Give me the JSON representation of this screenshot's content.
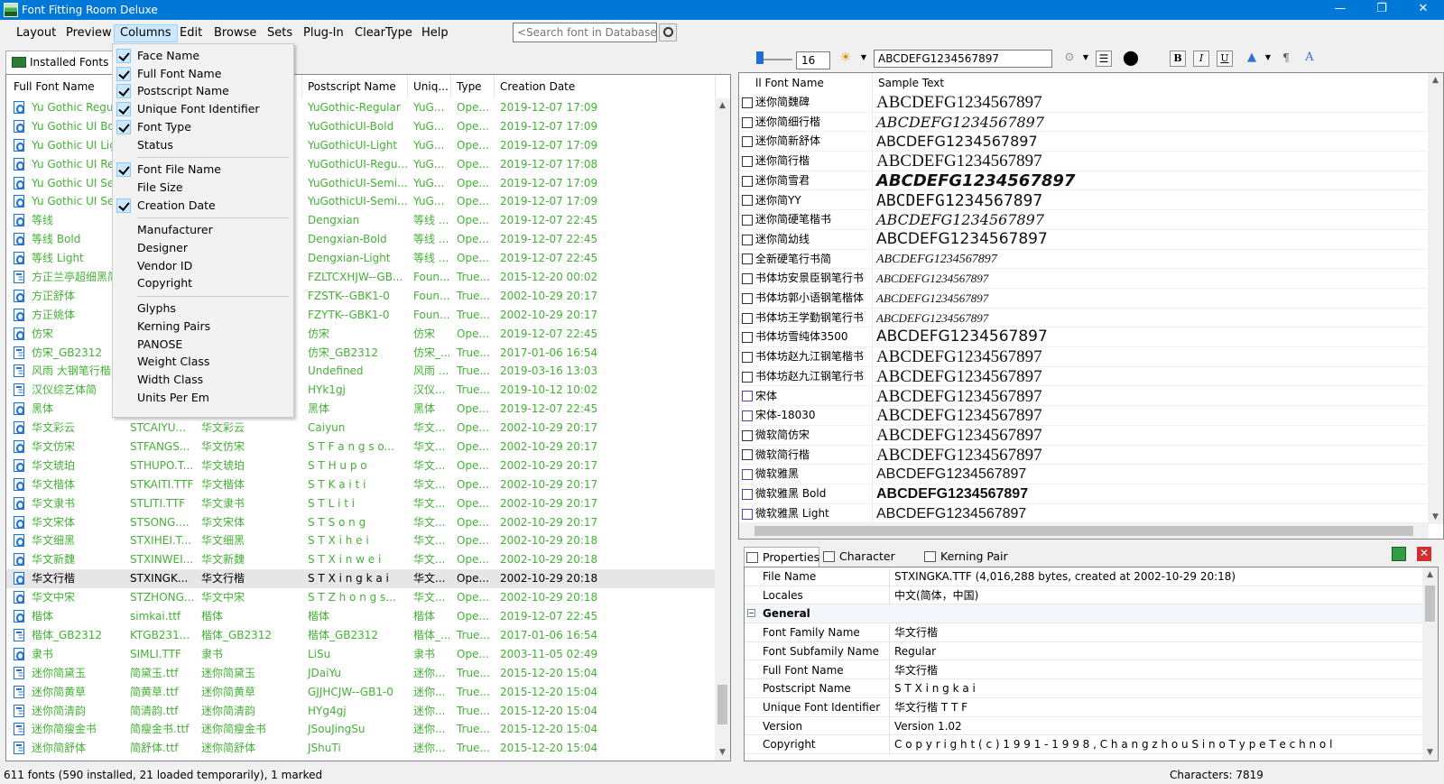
{
  "window": {
    "title": "Font Fitting Room Deluxe"
  },
  "menu": [
    "Layout",
    "Preview",
    "Columns",
    "Edit",
    "Browse",
    "Sets",
    "Plug-In",
    "ClearType",
    "Help"
  ],
  "search": {
    "placeholder": "<Search font in Database>"
  },
  "left_tab": "Installed Fonts",
  "columns_menu": [
    {
      "label": "Face Name",
      "checked": true
    },
    {
      "label": "Full Font Name",
      "checked": true
    },
    {
      "label": "Postscript Name",
      "checked": true
    },
    {
      "label": "Unique Font Identifier",
      "checked": true
    },
    {
      "label": "Font Type",
      "checked": true
    },
    {
      "label": "Status",
      "checked": false
    },
    {
      "sep": true
    },
    {
      "label": "Font File Name",
      "checked": true
    },
    {
      "label": "File Size",
      "checked": false
    },
    {
      "label": "Creation Date",
      "checked": true
    },
    {
      "sep": true
    },
    {
      "label": "Manufacturer",
      "checked": false
    },
    {
      "label": "Designer",
      "checked": false
    },
    {
      "label": "Vendor ID",
      "checked": false
    },
    {
      "label": "Copyright",
      "checked": false
    },
    {
      "sep": true
    },
    {
      "label": "Glyphs",
      "checked": false
    },
    {
      "label": "Kerning Pairs",
      "checked": false
    },
    {
      "label": "PANOSE",
      "checked": false
    },
    {
      "label": "Weight Class",
      "checked": false
    },
    {
      "label": "Width Class",
      "checked": false
    },
    {
      "label": "Units Per Em",
      "checked": false
    }
  ],
  "font_table": {
    "headers": [
      "Full Font Name",
      "Postscript Name",
      "Uniq...",
      "Type",
      "Creation Date"
    ],
    "rows": [
      [
        "o",
        "Yu Gothic Regul",
        "",
        "",
        "YuGothic-Regular",
        "YuG...",
        "Ope...",
        "2019-12-07 17:09"
      ],
      [
        "o",
        "Yu Gothic UI Bol",
        "",
        "",
        "YuGothicUI-Bold",
        "YuG...",
        "Ope...",
        "2019-12-07 17:09"
      ],
      [
        "o",
        "Yu Gothic UI Lig",
        "",
        "",
        "YuGothicUI-Light",
        "YuG...",
        "Ope...",
        "2019-12-07 17:09"
      ],
      [
        "o",
        "Yu Gothic UI Re.",
        "",
        "",
        "YuGothicUI-Regu...",
        "YuG...",
        "Ope...",
        "2019-12-07 17:08"
      ],
      [
        "o",
        "Yu Gothic UI Se.",
        "",
        "",
        "YuGothicUI-Semi...",
        "YuG...",
        "Ope...",
        "2019-12-07 17:09"
      ],
      [
        "o",
        "Yu Gothic UI Se.",
        "",
        "",
        "YuGothicUI-Semi...",
        "YuG...",
        "Ope...",
        "2019-12-07 17:09"
      ],
      [
        "o",
        "等线",
        "",
        "",
        "Dengxian",
        "等线 ...",
        "Ope...",
        "2019-12-07 22:45"
      ],
      [
        "o",
        "等线 Bold",
        "",
        "",
        "Dengxian-Bold",
        "等线 ...",
        "Ope...",
        "2019-12-07 22:45"
      ],
      [
        "o",
        "等线 Light",
        "",
        "",
        "Dengxian-Light",
        "等线 ...",
        "Ope...",
        "2019-12-07 22:45"
      ],
      [
        "t",
        "方正兰亭超细黑简",
        "",
        "",
        "FZLTCXHJW--GB...",
        "Foun...",
        "True...",
        "2015-12-20 00:02"
      ],
      [
        "o",
        "方正舒体",
        "",
        "",
        "FZSTK--GBK1-0",
        "Foun...",
        "True...",
        "2002-10-29 20:17"
      ],
      [
        "o",
        "方正姚体",
        "",
        "",
        "FZYTK--GBK1-0",
        "Foun...",
        "True...",
        "2002-10-29 20:17"
      ],
      [
        "o",
        "仿宋",
        "",
        "",
        "仿宋",
        "仿宋",
        "Ope...",
        "2019-12-07 22:45"
      ],
      [
        "t",
        "仿宋_GB2312",
        "",
        "",
        "仿宋_GB2312",
        "仿宋_...",
        "True...",
        "2017-01-06 16:54"
      ],
      [
        "t",
        "风雨 大钢笔行楷",
        "",
        "",
        "Undefined",
        "风雨 ...",
        "True...",
        "2019-03-16 13:03"
      ],
      [
        "t",
        "汉仪综艺体简",
        "",
        "",
        "HYk1gj",
        "汉仪...",
        "True...",
        "2019-10-12 10:02"
      ],
      [
        "o",
        "黑体",
        "",
        "",
        "黑体",
        "黑体",
        "Ope...",
        "2019-12-07 22:45"
      ],
      [
        "o",
        "华文彩云",
        "STCAIYU...",
        "华文彩云",
        "Caiyun",
        "华文...",
        "Ope...",
        "2002-10-29 20:17"
      ],
      [
        "o",
        "华文仿宋",
        "STFANGS...",
        "华文仿宋",
        "S T F a n g s o...",
        "华文...",
        "Ope...",
        "2002-10-29 20:17"
      ],
      [
        "o",
        "华文琥珀",
        "STHUPO.T...",
        "华文琥珀",
        "S T H u p o",
        "华文...",
        "Ope...",
        "2002-10-29 20:17"
      ],
      [
        "o",
        "华文楷体",
        "STKAITI.TTF",
        "华文楷体",
        "S T K a i t i",
        "华文...",
        "Ope...",
        "2002-10-29 20:17"
      ],
      [
        "o",
        "华文隶书",
        "STLITI.TTF",
        "华文隶书",
        "S T L i t i",
        "华文...",
        "Ope...",
        "2002-10-29 20:17"
      ],
      [
        "o",
        "华文宋体",
        "STSONG....",
        "华文宋体",
        "S T S o n g",
        "华文...",
        "Ope...",
        "2002-10-29 20:17"
      ],
      [
        "o",
        "华文细黑",
        "STXIHEI.T...",
        "华文细黑",
        "S T X i h e i",
        "华文...",
        "Ope...",
        "2002-10-29 20:18"
      ],
      [
        "o",
        "华文新魏",
        "STXINWEI...",
        "华文新魏",
        "S T X i n w e i",
        "华文...",
        "Ope...",
        "2002-10-29 20:18"
      ],
      [
        "o",
        "华文行楷",
        "STXINGK...",
        "华文行楷",
        "S T X i n g k a i",
        "华文...",
        "Ope...",
        "2002-10-29 20:18"
      ],
      [
        "o",
        "华文中宋",
        "STZHONG...",
        "华文中宋",
        "S T Z h o n g s...",
        "华文...",
        "Ope...",
        "2002-10-29 20:18"
      ],
      [
        "o",
        "楷体",
        "simkai.ttf",
        "楷体",
        "楷体",
        "楷体",
        "Ope...",
        "2019-12-07 22:45"
      ],
      [
        "t",
        "楷体_GB2312",
        "KTGB231...",
        "楷体_GB2312",
        "楷体_GB2312",
        "楷体_...",
        "True...",
        "2017-01-06 16:54"
      ],
      [
        "o",
        "隶书",
        "SIMLI.TTF",
        "隶书",
        "LiSu",
        "隶书",
        "Ope...",
        "2003-11-05 02:49"
      ],
      [
        "t",
        "迷你简黛玉",
        "简黛玉.ttf",
        "迷你简黛玉",
        "JDaiYu",
        "迷你...",
        "True...",
        "2015-12-20 15:04"
      ],
      [
        "t",
        "迷你简黄草",
        "简黄草.ttf",
        "迷你简黄草",
        "GJJHCJW--GB1-0",
        "迷你...",
        "True...",
        "2015-12-20 15:04"
      ],
      [
        "t",
        "迷你简清韵",
        "简清韵.ttf",
        "迷你简清韵",
        "HYg4gj",
        "迷你...",
        "True...",
        "2015-12-20 15:04"
      ],
      [
        "t",
        "迷你简瘦金书",
        "简瘦金书.ttf",
        "迷你简瘦金书",
        "JSouJingSu",
        "迷你...",
        "True...",
        "2015-12-20 15:04"
      ],
      [
        "t",
        "迷你简舒体",
        "简舒体.ttf",
        "迷你简舒体",
        "JShuTi",
        "迷你...",
        "True...",
        "2015-12-20 15:04"
      ]
    ],
    "selected_index": 25
  },
  "toolbar": {
    "size": "16",
    "sample": "ABCDEFG1234567897",
    "bold": "B",
    "italic": "I",
    "underline": "U"
  },
  "sample_table": {
    "headers": [
      "ll Font Name",
      "Sample Text"
    ],
    "rows": [
      [
        "迷你简魏碑",
        "ABCDEFG1234567897"
      ],
      [
        "迷你简细行楷",
        "ABCDEFG1234567897"
      ],
      [
        "迷你简新舒体",
        "ABCDEFG1234567897"
      ],
      [
        "迷你简行楷",
        "ABCDEFG1234567897"
      ],
      [
        "迷你简雪君",
        "ABCDEFG1234567897"
      ],
      [
        "迷你简YY",
        "ABCDEFG1234567897"
      ],
      [
        "迷你简硬笔楷书",
        "ABCDEFG1234567897"
      ],
      [
        "迷你简幼线",
        "ABCDEFG1234567897"
      ],
      [
        "全新硬笔行书简",
        "ABCDEFG1234567897"
      ],
      [
        "书体坊安景臣钢笔行书",
        "ABCDEFG1234567897"
      ],
      [
        "书体坊郭小语钢笔楷体",
        "ABCDEFG1234567897"
      ],
      [
        "书体坊王学勤钢笔行书",
        "ABCDEFG1234567897"
      ],
      [
        "书体坊雪纯体3500",
        "ABCDEFG1234567897"
      ],
      [
        "书体坊赵九江钢笔楷书",
        "ABCDEFG1234567897"
      ],
      [
        "书体坊赵九江钢笔行书",
        "ABCDEFG1234567897"
      ],
      [
        "宋体",
        "ABCDEFG1234567897"
      ],
      [
        "宋体-18030",
        "ABCDEFG1234567897"
      ],
      [
        "微软简仿宋",
        "ABCDEFG1234567897"
      ],
      [
        "微软简行楷",
        "ABCDEFG1234567897"
      ],
      [
        "微软雅黑",
        "ABCDEFG1234567897"
      ],
      [
        "微软雅黑 Bold",
        "ABCDEFG1234567897"
      ],
      [
        "微软雅黑 Light",
        "ABCDEFG1234567897"
      ]
    ]
  },
  "prop_tabs": [
    "Properties",
    "Character Map",
    "Kerning Pair"
  ],
  "properties": [
    {
      "key": "File Name",
      "value": "STXINGKA.TTF (4,016,288 bytes, created at 2002-10-29 20:18)"
    },
    {
      "key": "Locales",
      "value": "中文(简体，中国)"
    },
    {
      "key": "General",
      "value": "",
      "group": true
    },
    {
      "key": "Font Family Name",
      "value": "华文行楷"
    },
    {
      "key": "Font Subfamily Name",
      "value": "Regular"
    },
    {
      "key": "Full Font Name",
      "value": "华文行楷"
    },
    {
      "key": "Postscript Name",
      "value": "S T X i n g k a i"
    },
    {
      "key": "Unique Font Identifier",
      "value": "华文行楷  T T F"
    },
    {
      "key": "Version",
      "value": "Version 1.02"
    },
    {
      "key": "Copyright",
      "value": "C o p y r i g h t  ( c )  1 9 9 1 - 1 9 9 8 ,  C h a n g z h o u   S i n o T y p e   T e c h n o l"
    }
  ],
  "status": {
    "left": "611 fonts (590 installed, 21 loaded temporarily), 1 marked",
    "right": "Characters: 7819"
  }
}
